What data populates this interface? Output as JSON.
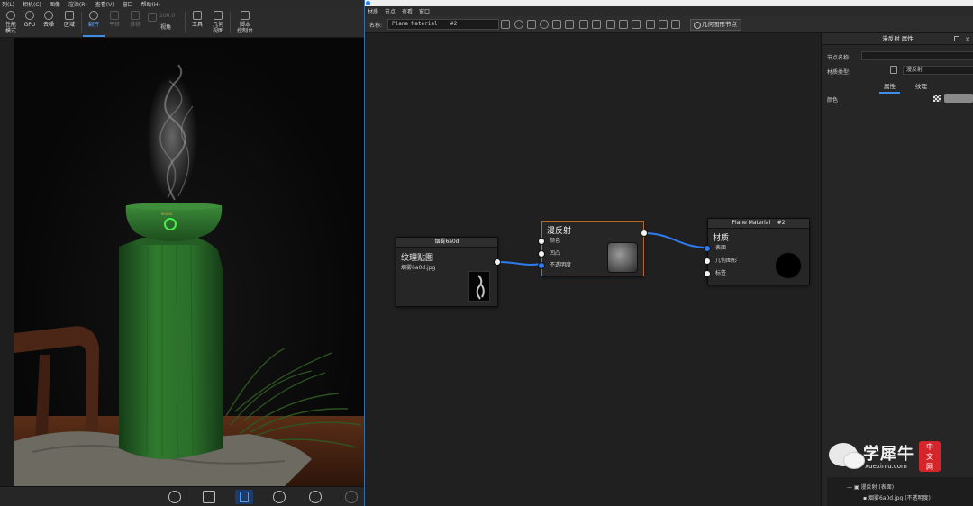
{
  "left": {
    "menu": [
      "列(L)",
      "相机(C)",
      "图像",
      "渲染(R)",
      "查看(V)",
      "窗口",
      "帮助(H)"
    ],
    "toolbar": [
      {
        "label": "性能\n模式",
        "icon": "gauge-icon"
      },
      {
        "label": "GPU",
        "icon": "chip-icon"
      },
      {
        "label": "去噪",
        "icon": "denoise-icon"
      },
      {
        "label": "区域",
        "icon": "region-icon"
      },
      {
        "label": "翻开",
        "icon": "refresh-icon",
        "active": true
      },
      {
        "label": "平移",
        "icon": "move-icon",
        "disabled": true
      },
      {
        "label": "推移",
        "icon": "dolly-icon",
        "disabled": true
      },
      {
        "label": "100.0",
        "icon": "fov-icon",
        "disabled": true
      },
      {
        "label": "视角",
        "icon": ""
      },
      {
        "label": "工具",
        "icon": "tools-icon"
      },
      {
        "label": "几何\n视图",
        "icon": "geometry-view-icon"
      },
      {
        "label": "脚本\n控制台",
        "icon": "script-console-icon"
      }
    ],
    "bottom_icons": [
      "import-icon",
      "library-icon",
      "list-icon",
      "play-icon",
      "model-icon",
      "sphere-icon"
    ],
    "product_logo": "BRAND"
  },
  "right": {
    "menu": [
      "材质",
      "节点",
      "查看",
      "窗口"
    ],
    "toolbar": {
      "name_label": "名称:",
      "name_value": "Plane Material    #2",
      "geometry_node_btn": "几何图形节点"
    },
    "nodes": {
      "texture": {
        "header": "烟雾6a0d",
        "title": "纹理贴图",
        "file": "烟雾6a0d.jpg"
      },
      "diffuse": {
        "title": "漫反射",
        "ports": [
          "颜色",
          "凹凸",
          "不透明度"
        ]
      },
      "material": {
        "header": "Plane Material    #2",
        "title": "材质",
        "ports": [
          "表面",
          "几何图形",
          "标签"
        ]
      }
    },
    "panel": {
      "title": "漫反射 属性",
      "node_name_label": "节点名称:",
      "material_type_label": "材质类型:",
      "material_type_value": "漫反射",
      "tabs": [
        "属性",
        "纹理"
      ],
      "color_label": "颜色",
      "tree": [
        {
          "label": "漫反射 (表面)"
        },
        {
          "label": "烟雾6a0d.jpg (不透明度)"
        }
      ]
    }
  },
  "watermark": {
    "brand": "学犀牛",
    "url": "xuexiniu.com",
    "badge": [
      "中",
      "文",
      "网"
    ]
  },
  "colors": {
    "accent": "#3f8de6",
    "link": "#2f7bf0",
    "selected_node": "#b56a22",
    "product_green": "#2f6f2d"
  }
}
